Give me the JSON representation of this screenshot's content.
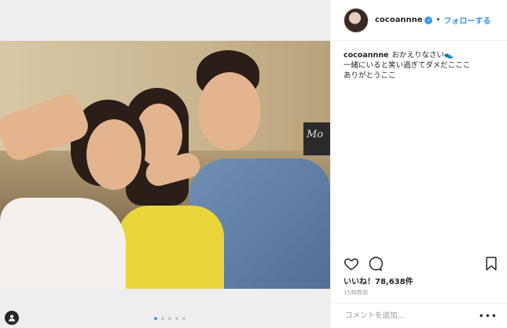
{
  "post": {
    "image_alt": "",
    "carousel": {
      "count": 5,
      "active_index": 0
    }
  },
  "header": {
    "username": "cocoannne",
    "verified_icon": "verified-badge-icon",
    "separator": "•",
    "follow_label": "フォローする"
  },
  "caption": {
    "username": "cocoannne",
    "lines": [
      "おかえりなさい👟",
      "一緒にいると笑い過ぎてダメだこここ",
      "ありがとうここ"
    ]
  },
  "actions": {
    "like_icon": "heart-icon",
    "comment_icon": "comment-icon",
    "save_icon": "bookmark-icon"
  },
  "likes_text": "いいね！78,638件",
  "timestamp": "15時間前",
  "comment": {
    "placeholder": "コメントを追加...",
    "more_icon": "more-icon"
  },
  "colors": {
    "accent": "#3897f0",
    "text": "#262626",
    "muted": "#999999",
    "border": "#efefef"
  }
}
